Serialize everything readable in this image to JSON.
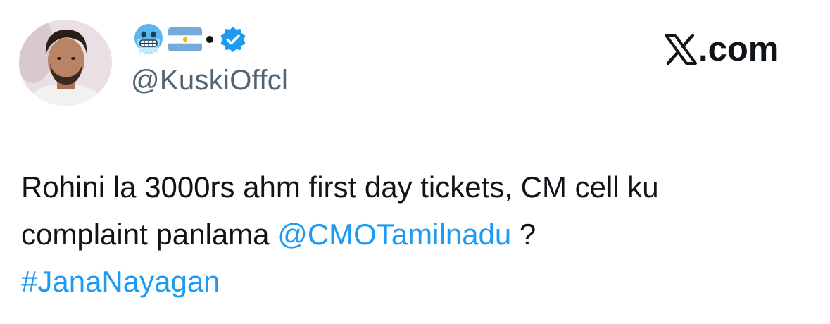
{
  "tweet": {
    "author": {
      "display_name_emojis": [
        "cold-face-emoji",
        "argentina-flag-emoji"
      ],
      "verified": true,
      "handle": "@KuskiOffcl"
    },
    "brand": {
      "label": ".com",
      "icon": "x-logo-icon"
    },
    "body": {
      "line1": "Rohini la 3000rs ahm first day tickets, CM cell ku",
      "line2_text": "complaint panlama ",
      "mention": "@CMOTamilnadu",
      "line2_tail": " ?",
      "hashtag": "#JanaNayagan"
    },
    "colors": {
      "link": "#1d9bf0",
      "text": "#0f1419",
      "handle": "#536471",
      "verified": "#1d9bf0"
    }
  }
}
